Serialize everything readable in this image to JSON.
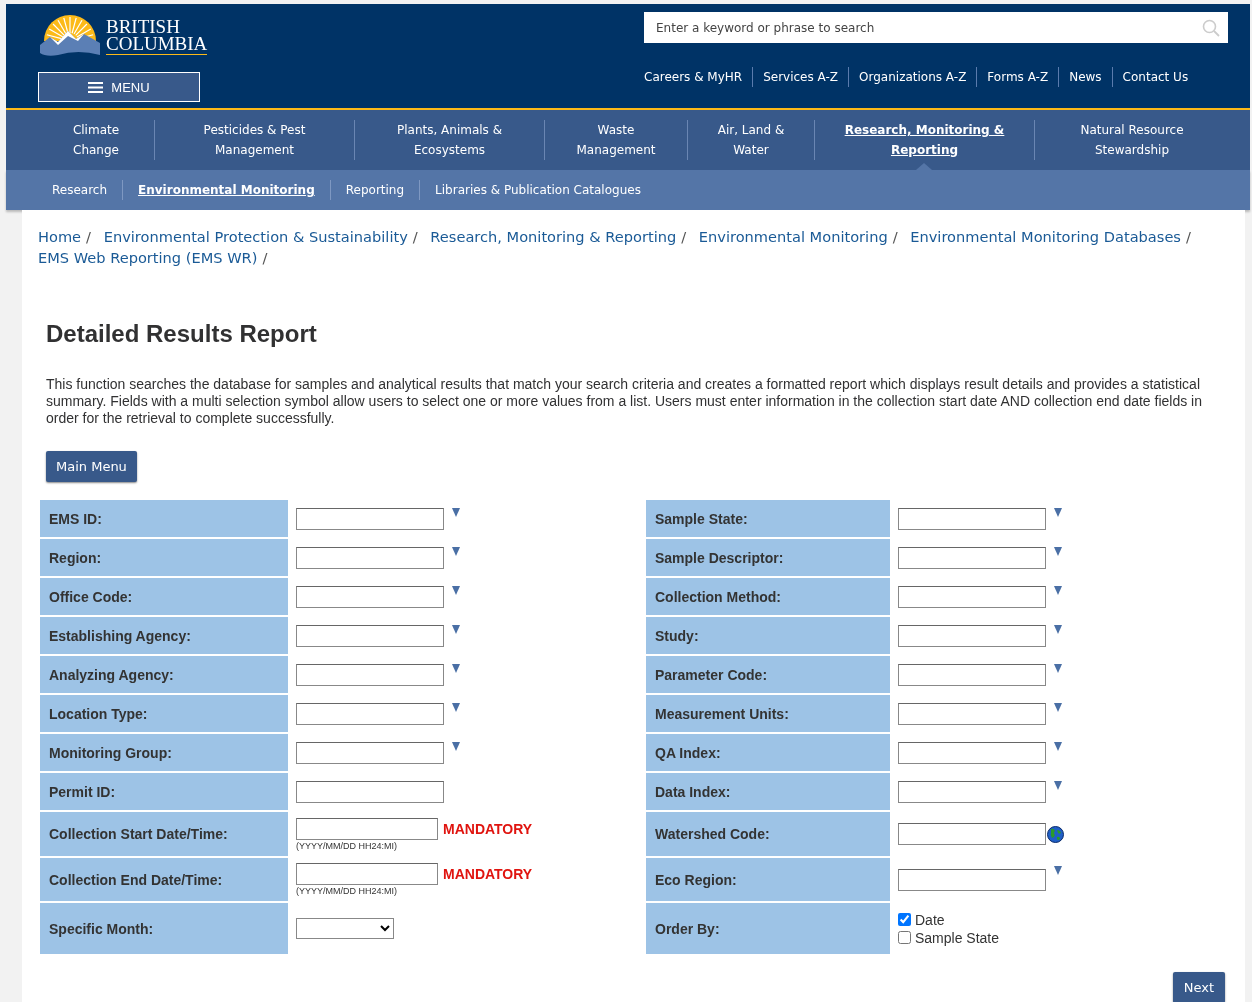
{
  "header": {
    "logo_line1": "BRITISH",
    "logo_line2": "COLUMBIA",
    "menu_button": "MENU",
    "search": {
      "placeholder": "Enter a keyword or phrase to search"
    },
    "top_links": [
      "Careers & MyHR",
      "Services A-Z",
      "Organizations A-Z",
      "Forms A-Z",
      "News",
      "Contact Us"
    ]
  },
  "nav": [
    {
      "label": "Climate Change",
      "selected": false
    },
    {
      "label": "Pesticides & Pest Management",
      "selected": false
    },
    {
      "label": "Plants, Animals & Ecosystems",
      "selected": false
    },
    {
      "label": "Waste Management",
      "selected": false
    },
    {
      "label": "Air, Land & Water",
      "selected": false
    },
    {
      "label": "Research, Monitoring & Reporting",
      "selected": true
    },
    {
      "label": "Natural Resource Stewardship",
      "selected": false
    }
  ],
  "subnav": [
    {
      "label": "Research",
      "selected": false
    },
    {
      "label": "Environmental Monitoring",
      "selected": true
    },
    {
      "label": "Reporting",
      "selected": false
    },
    {
      "label": "Libraries & Publication Catalogues",
      "selected": false
    }
  ],
  "breadcrumbs": [
    {
      "label": "Home",
      "separator": "/"
    },
    {
      "label": "Environmental Protection & Sustainability",
      "separator": "/"
    },
    {
      "label": "Research, Monitoring & Reporting",
      "separator": "/"
    },
    {
      "label": "Environmental Monitoring",
      "separator": "/"
    },
    {
      "label": "Environmental Monitoring Databases",
      "separator": "/"
    },
    {
      "label": "EMS Web Reporting (EMS WR)",
      "separator": "/"
    }
  ],
  "title": "Detailed Results Report",
  "description": "This function searches the database for samples and analytical results that match your search criteria and creates a formatted report which displays result details and provides a statistical summary. Fields with a multi selection symbol allow users to select one or more values from a list. Users must enter information in the collection start date AND collection end date fields in order for the retrieval to complete successfully.",
  "main_menu_button": "Main Menu",
  "left_fields": [
    {
      "label": "EMS ID:",
      "kind": "list"
    },
    {
      "label": "Region:",
      "kind": "list"
    },
    {
      "label": "Office Code:",
      "kind": "list"
    },
    {
      "label": "Establishing Agency:",
      "kind": "list"
    },
    {
      "label": "Analyzing Agency:",
      "kind": "list"
    },
    {
      "label": "Location Type:",
      "kind": "list"
    },
    {
      "label": "Monitoring Group:",
      "kind": "list"
    },
    {
      "label": "Permit ID:",
      "kind": "text"
    },
    {
      "label": "Collection Start Date/Time:",
      "kind": "date",
      "note": "MANDATORY",
      "hint": "(YYYY/MM/DD HH24:MI)"
    },
    {
      "label": "Collection End Date/Time:",
      "kind": "date",
      "note": "MANDATORY",
      "hint": "(YYYY/MM/DD HH24:MI)"
    },
    {
      "label": "Specific Month:",
      "kind": "select"
    }
  ],
  "right_fields": [
    {
      "label": "Sample State:",
      "kind": "list"
    },
    {
      "label": "Sample Descriptor:",
      "kind": "list"
    },
    {
      "label": "Collection Method:",
      "kind": "list"
    },
    {
      "label": "Study:",
      "kind": "list"
    },
    {
      "label": "Parameter Code:",
      "kind": "list"
    },
    {
      "label": "Measurement Units:",
      "kind": "list"
    },
    {
      "label": "QA Index:",
      "kind": "list"
    },
    {
      "label": "Data Index:",
      "kind": "list"
    },
    {
      "label": "Watershed Code:",
      "kind": "globe"
    },
    {
      "label": "Eco Region:",
      "kind": "list"
    },
    {
      "label": "Order By:",
      "kind": "checkboxes",
      "options": [
        {
          "label": "Date",
          "checked": true
        },
        {
          "label": "Sample State",
          "checked": false
        }
      ]
    }
  ],
  "next_button": "Next"
}
